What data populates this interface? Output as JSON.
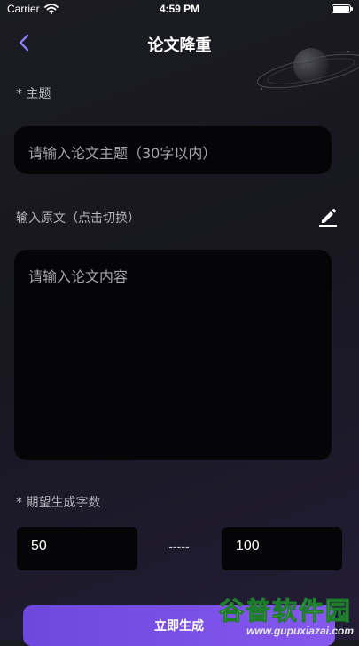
{
  "status_bar": {
    "carrier": "Carrier",
    "time": "4:59 PM"
  },
  "nav": {
    "title": "论文降重"
  },
  "topic": {
    "label": "* 主题",
    "placeholder": "请输入论文主题（30字以内）"
  },
  "source": {
    "label": "输入原文（点击切换）",
    "placeholder": "请输入论文内容"
  },
  "word_count": {
    "label": "* 期望生成字数",
    "min": "50",
    "separator": "-----",
    "max": "100"
  },
  "generate": {
    "label": "立即生成"
  },
  "watermark": {
    "brand": "谷普软件园",
    "url": "www.gupuxiazai.com"
  },
  "colors": {
    "accent": "#7a52e6",
    "background": "#1b1b22",
    "field": "#050507",
    "back_icon": "#8a7ff0"
  },
  "icons": [
    "chevron-left-icon",
    "wifi-icon",
    "battery-icon",
    "edit-icon",
    "planet-icon"
  ]
}
